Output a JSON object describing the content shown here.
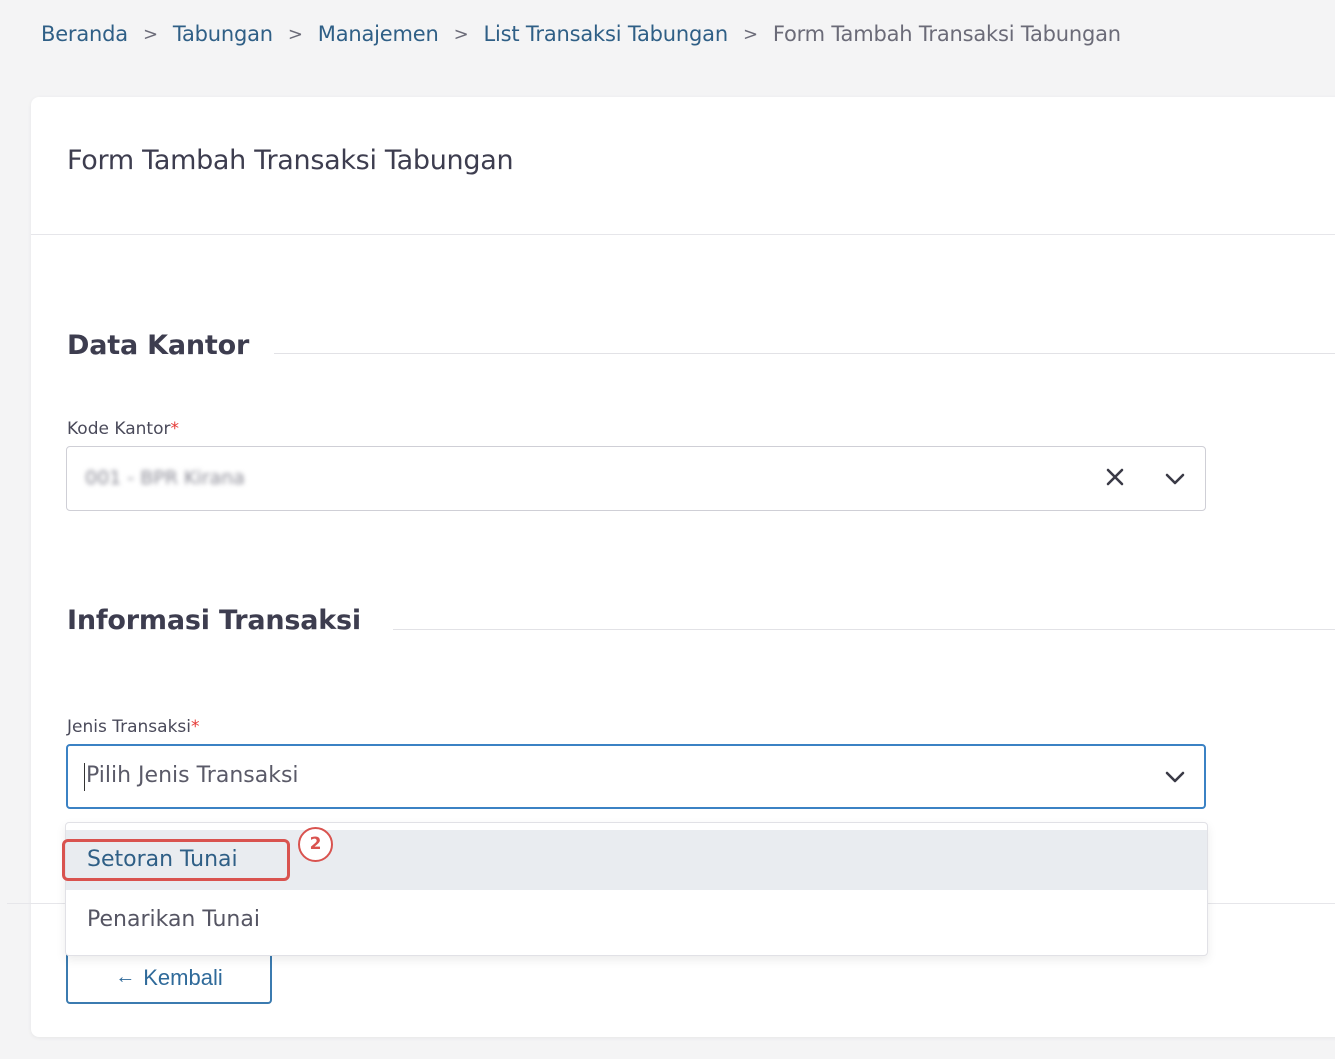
{
  "breadcrumb": {
    "items": [
      "Beranda",
      "Tabungan",
      "Manajemen",
      "List Transaksi Tabungan"
    ],
    "current": "Form Tambah Transaksi Tabungan",
    "separator": ">"
  },
  "form": {
    "title": "Form Tambah Transaksi Tabungan",
    "section_office": "Data Kantor",
    "office_code_label": "Kode Kantor",
    "office_code_value": "001 - BPR Kirana",
    "section_transaction": "Informasi Transaksi",
    "transaction_type_label": "Jenis Transaksi",
    "transaction_type_placeholder": "Pilih Jenis Transaksi",
    "required_mark": "*",
    "options": [
      "Setoran Tunai",
      "Penarikan Tunai"
    ],
    "back_label": "Kembali"
  },
  "annotation": {
    "step": "2"
  },
  "colors": {
    "link": "#2f5f86",
    "focus_border": "#3b82c4",
    "highlight": "#d9534f"
  }
}
